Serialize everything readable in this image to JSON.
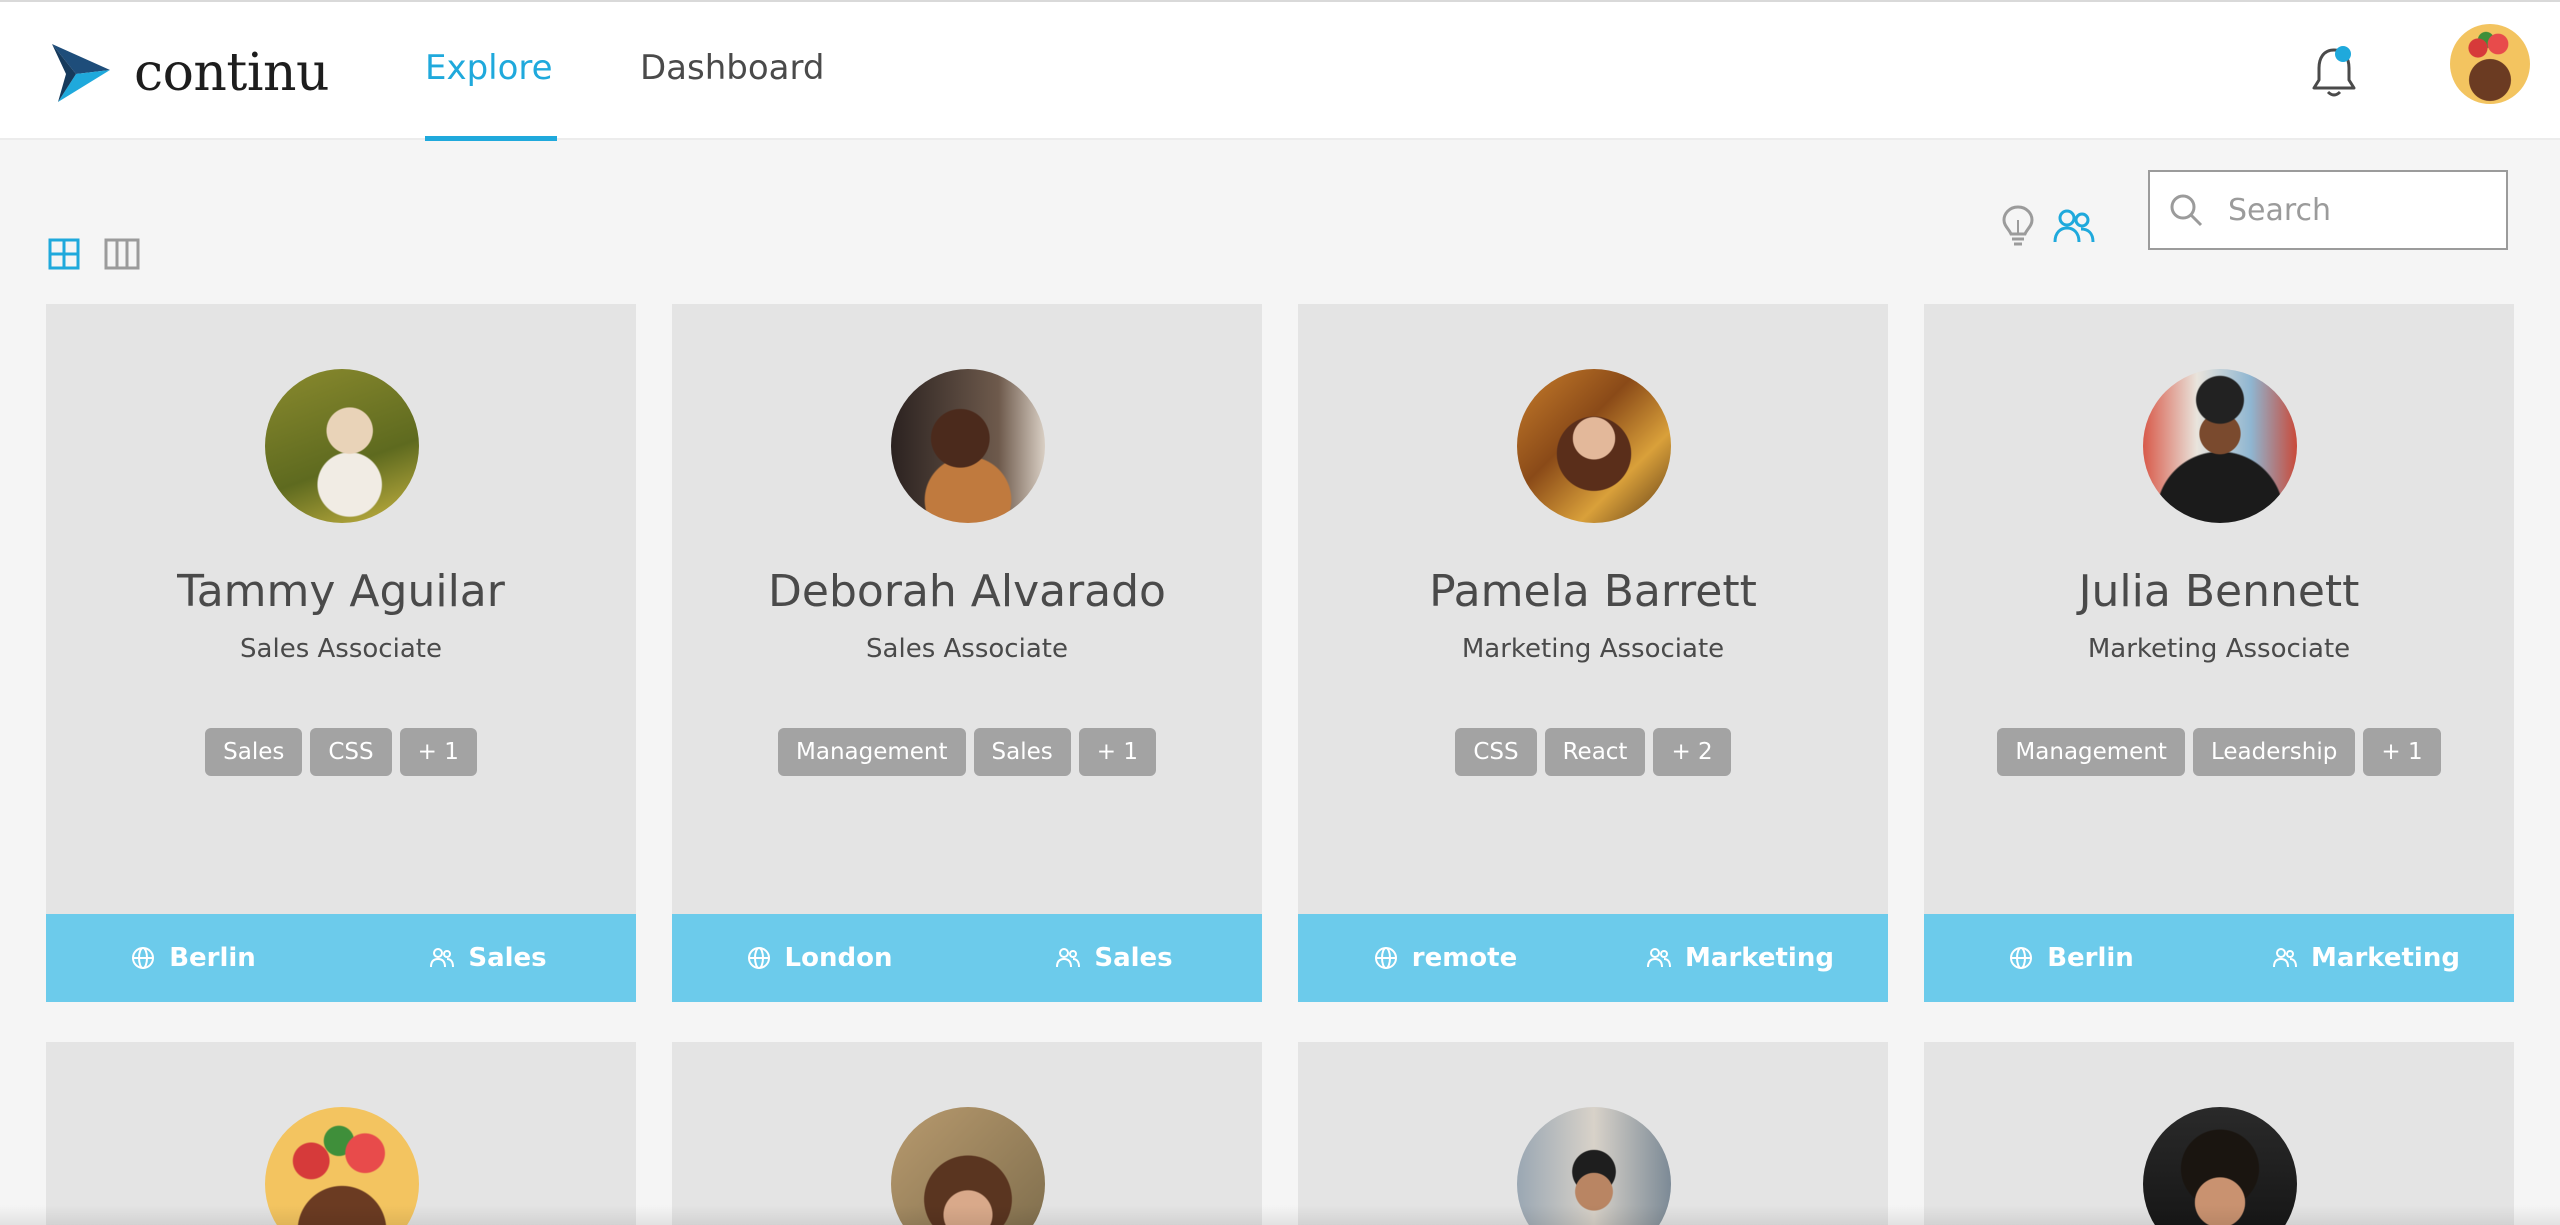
{
  "app": {
    "logo_text": "continu"
  },
  "nav": {
    "tabs": [
      {
        "label": "Explore",
        "active": true
      },
      {
        "label": "Dashboard",
        "active": false
      }
    ]
  },
  "header": {
    "notification_icon": "bell-icon",
    "has_unread": true
  },
  "toolbar": {
    "view_modes": [
      "grid-view-icon",
      "column-view-icon"
    ],
    "active_view": "grid",
    "filter_icons": [
      "lightbulb-icon",
      "people-icon"
    ],
    "active_filter": "people"
  },
  "search": {
    "placeholder": "Search",
    "value": ""
  },
  "colors": {
    "accent": "#1fa9dc",
    "card_footer": "#6ccbeb",
    "tag": "#a3a3a3",
    "card": "#e4e4e4"
  },
  "people": [
    {
      "name": "Tammy Aguilar",
      "role": "Sales Associate",
      "tags": [
        "Sales",
        "CSS",
        "+ 1"
      ],
      "location": "Berlin",
      "team": "Sales"
    },
    {
      "name": "Deborah Alvarado",
      "role": "Sales Associate",
      "tags": [
        "Management",
        "Sales",
        "+ 1"
      ],
      "location": "London",
      "team": "Sales"
    },
    {
      "name": "Pamela Barrett",
      "role": "Marketing Associate",
      "tags": [
        "CSS",
        "React",
        "+ 2"
      ],
      "location": "remote",
      "team": "Marketing"
    },
    {
      "name": "Julia Bennett",
      "role": "Marketing Associate",
      "tags": [
        "Management",
        "Leadership",
        "+ 1"
      ],
      "location": "Berlin",
      "team": "Marketing"
    }
  ]
}
